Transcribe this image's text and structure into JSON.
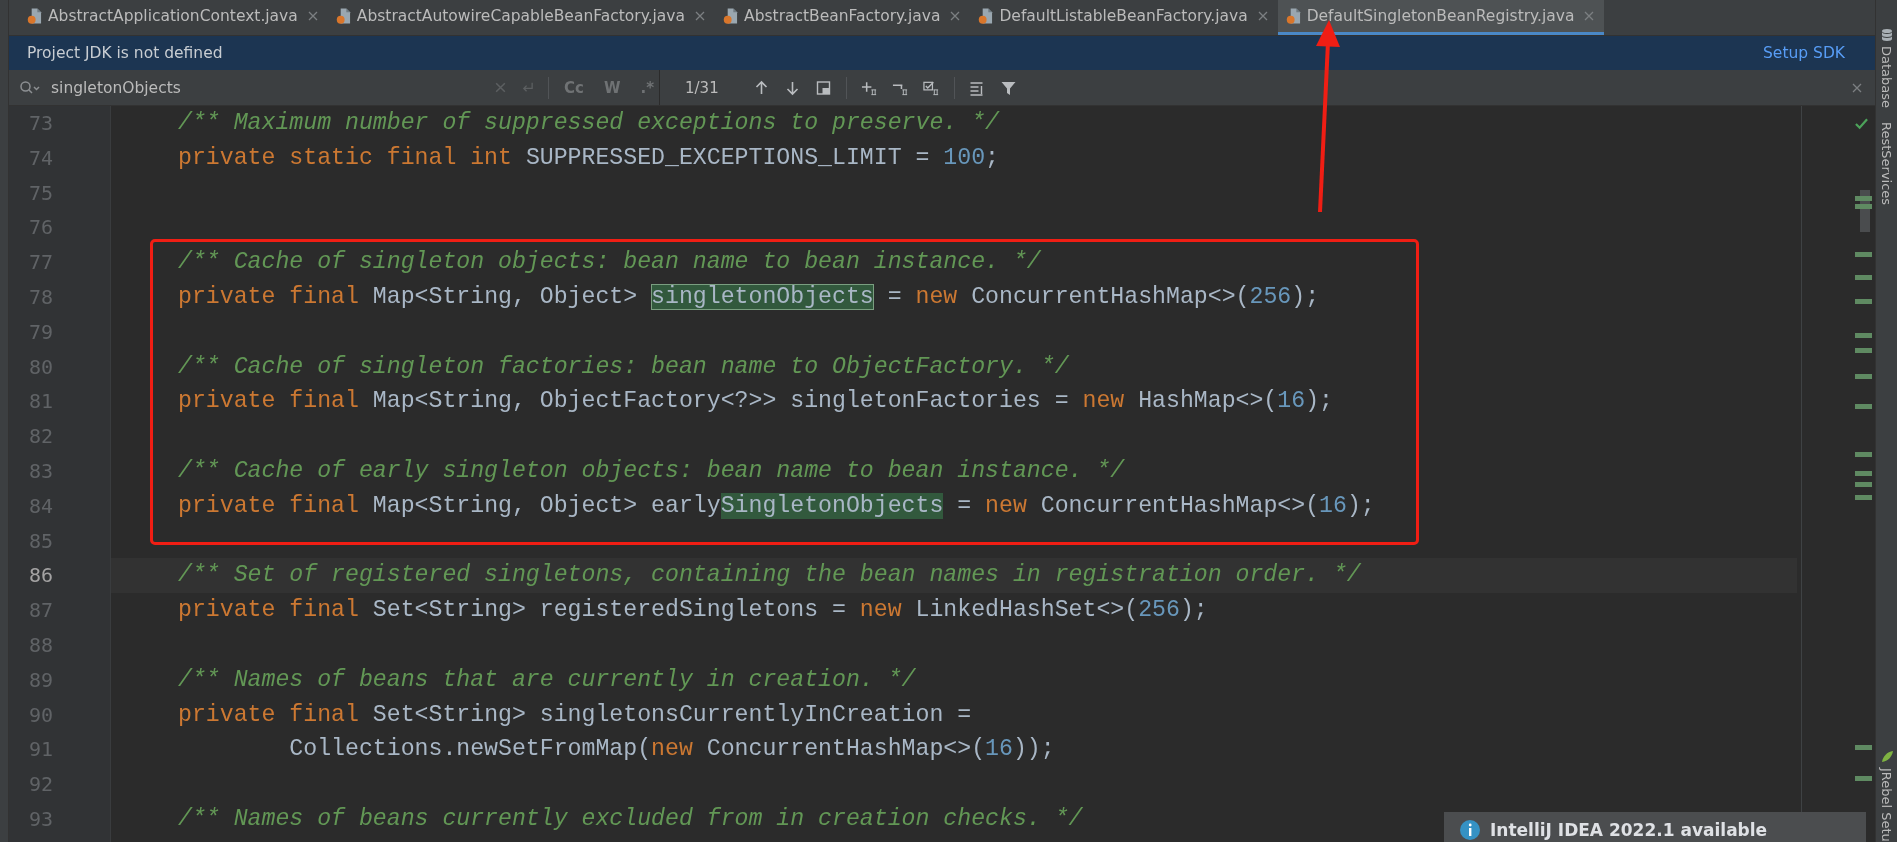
{
  "tabs": [
    {
      "label": "AbstractApplicationContext.java",
      "selected": false
    },
    {
      "label": "AbstractAutowireCapableBeanFactory.java",
      "selected": false
    },
    {
      "label": "AbstractBeanFactory.java",
      "selected": false
    },
    {
      "label": "DefaultListableBeanFactory.java",
      "selected": false
    },
    {
      "label": "DefaultSingletonBeanRegistry.java",
      "selected": true
    }
  ],
  "banner": {
    "message": "Project JDK is not defined",
    "action": "Setup SDK"
  },
  "search": {
    "value": "singletonObjects",
    "options": [
      "Cc",
      "W",
      ".*"
    ],
    "match_count": "1/31"
  },
  "editor": {
    "lines": [
      {
        "number": "73",
        "current": false,
        "segments": [
          {
            "kind": "comment",
            "text": "/** Maximum number of suppressed exceptions to preserve. */"
          }
        ]
      },
      {
        "number": "74",
        "current": false,
        "segments": [
          {
            "kind": "keyword",
            "text": "private static final int "
          },
          {
            "kind": "plain",
            "text": "SUPPRESSED_EXCEPTIONS_LIMIT = "
          },
          {
            "kind": "number",
            "text": "100"
          },
          {
            "kind": "plain",
            "text": ";"
          }
        ]
      },
      {
        "number": "75",
        "current": false
      },
      {
        "number": "76",
        "current": false
      },
      {
        "number": "77",
        "current": false,
        "segments": [
          {
            "kind": "comment",
            "text": "/** Cache of singleton objects: bean name to bean instance. */"
          }
        ]
      },
      {
        "number": "78",
        "current": false,
        "segments": [
          {
            "kind": "keyword",
            "text": "private final "
          },
          {
            "kind": "plain",
            "text": "Map<String, Object> "
          },
          {
            "kind": "current_match",
            "text": "singletonObjects"
          },
          {
            "kind": "plain",
            "text": " = "
          },
          {
            "kind": "keyword",
            "text": "new "
          },
          {
            "kind": "plain",
            "text": "ConcurrentHashMap<>("
          },
          {
            "kind": "number",
            "text": "256"
          },
          {
            "kind": "plain",
            "text": ");"
          }
        ]
      },
      {
        "number": "79",
        "current": false
      },
      {
        "number": "80",
        "current": false,
        "segments": [
          {
            "kind": "comment",
            "text": "/** Cache of singleton factories: bean name to ObjectFactory. */"
          }
        ]
      },
      {
        "number": "81",
        "current": false,
        "segments": [
          {
            "kind": "keyword",
            "text": "private final "
          },
          {
            "kind": "plain",
            "text": "Map<String, ObjectFactory<?>> singletonFactories = "
          },
          {
            "kind": "keyword",
            "text": "new "
          },
          {
            "kind": "plain",
            "text": "HashMap<>("
          },
          {
            "kind": "number",
            "text": "16"
          },
          {
            "kind": "plain",
            "text": ");"
          }
        ]
      },
      {
        "number": "82",
        "current": false
      },
      {
        "number": "83",
        "current": false,
        "segments": [
          {
            "kind": "comment",
            "text": "/** Cache of early singleton objects: bean name to bean instance. */"
          }
        ]
      },
      {
        "number": "84",
        "current": false,
        "segments": [
          {
            "kind": "keyword",
            "text": "private final "
          },
          {
            "kind": "plain",
            "text": "Map<String, Object> early"
          },
          {
            "kind": "match",
            "text": "SingletonObjects"
          },
          {
            "kind": "plain",
            "text": " = "
          },
          {
            "kind": "keyword",
            "text": "new "
          },
          {
            "kind": "plain",
            "text": "ConcurrentHashMap<>("
          },
          {
            "kind": "number",
            "text": "16"
          },
          {
            "kind": "plain",
            "text": ");"
          }
        ]
      },
      {
        "number": "85",
        "current": false
      },
      {
        "number": "86",
        "current": true,
        "segments": [
          {
            "kind": "comment",
            "text": "/** Set of registered singletons, containing the bean names in registration order. */"
          }
        ]
      },
      {
        "number": "87",
        "current": false,
        "segments": [
          {
            "kind": "keyword",
            "text": "private final "
          },
          {
            "kind": "plain",
            "text": "Set<String> registeredSingletons = "
          },
          {
            "kind": "keyword",
            "text": "new "
          },
          {
            "kind": "plain",
            "text": "LinkedHashSet<>("
          },
          {
            "kind": "number",
            "text": "256"
          },
          {
            "kind": "plain",
            "text": ");"
          }
        ]
      },
      {
        "number": "88",
        "current": false
      },
      {
        "number": "89",
        "current": false,
        "segments": [
          {
            "kind": "comment",
            "text": "/** Names of beans that are currently in creation. */"
          }
        ]
      },
      {
        "number": "90",
        "current": false,
        "segments": [
          {
            "kind": "keyword",
            "text": "private final "
          },
          {
            "kind": "plain",
            "text": "Set<String> singletonsCurrentlyInCreation ="
          }
        ]
      },
      {
        "number": "91",
        "current": false,
        "segments": [
          {
            "kind": "plain",
            "text": "        Collections.newSetFromMap("
          },
          {
            "kind": "keyword",
            "text": "new "
          },
          {
            "kind": "plain",
            "text": "ConcurrentHashMap<>("
          },
          {
            "kind": "number",
            "text": "16"
          },
          {
            "kind": "plain",
            "text": "));"
          }
        ]
      },
      {
        "number": "92",
        "current": false
      },
      {
        "number": "93",
        "current": false,
        "segments": [
          {
            "kind": "comment",
            "text": "/** Names of beans currently excluded from in creation checks. */"
          }
        ]
      }
    ]
  },
  "tool_windows": [
    "Database",
    "RestServices",
    "JRebel Setu"
  ],
  "notification": {
    "title": "IntelliJ IDEA 2022.1 available"
  }
}
